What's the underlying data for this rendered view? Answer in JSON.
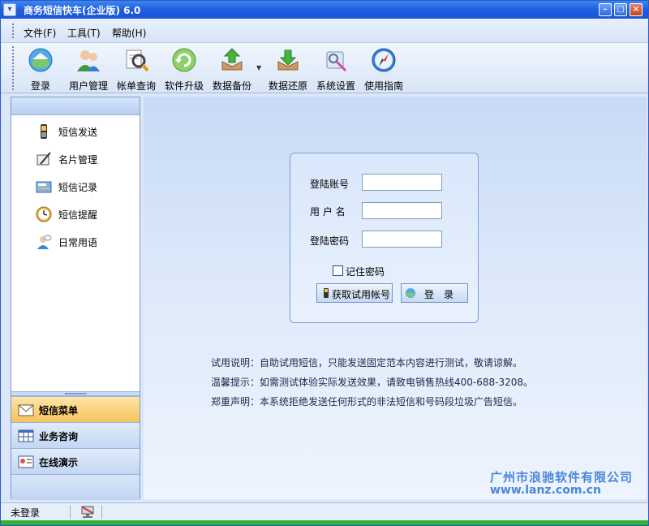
{
  "window": {
    "title": "商务短信快车(企业版) 6.0"
  },
  "menu": {
    "items": [
      "文件(F)",
      "工具(T)",
      "帮助(H)"
    ]
  },
  "toolbar": {
    "items": [
      {
        "label": "登录",
        "icon": "login-icon"
      },
      {
        "label": "用户管理",
        "icon": "users-icon"
      },
      {
        "label": "帐单查询",
        "icon": "billing-search-icon"
      },
      {
        "label": "软件升级",
        "icon": "upgrade-icon"
      },
      {
        "label": "数据备份",
        "icon": "backup-icon"
      },
      {
        "label": "数据还原",
        "icon": "restore-icon"
      },
      {
        "label": "系统设置",
        "icon": "settings-icon"
      },
      {
        "label": "使用指南",
        "icon": "guide-icon"
      }
    ]
  },
  "sidebar": {
    "items": [
      {
        "label": "短信发送",
        "icon": "mobile-phone-icon"
      },
      {
        "label": "名片管理",
        "icon": "business-card-icon"
      },
      {
        "label": "短信记录",
        "icon": "sms-record-icon"
      },
      {
        "label": "短信提醒",
        "icon": "clock-reminder-icon"
      },
      {
        "label": "日常用语",
        "icon": "phrases-icon"
      }
    ],
    "nav": [
      {
        "label": "短信菜单",
        "icon": "envelope-icon",
        "active": true
      },
      {
        "label": "业务咨询",
        "icon": "calendar-grid-icon",
        "active": false
      },
      {
        "label": "在线演示",
        "icon": "id-card-icon",
        "active": false
      }
    ]
  },
  "login": {
    "account_label": "登陆账号",
    "username_label": "用 户 名",
    "password_label": "登陆密码",
    "account_value": "",
    "username_value": "",
    "password_value": "",
    "remember_label": "记住密码",
    "remember_checked": false,
    "trial_button": "获取试用帐号",
    "login_button": "登　录"
  },
  "notices": [
    "试用说明：自助试用短信，只能发送固定范本内容进行测试，敬请谅解。",
    "温馨提示：如需测试体验实际发送效果，请致电销售热线400-688-3208。",
    "郑重声明：本系统拒绝发送任何形式的非法短信和号码段垃圾广告短信。"
  ],
  "watermark": {
    "company": "广州市浪驰软件有限公司",
    "url": "www.lanz.com.cn"
  },
  "status": {
    "text": "未登录"
  },
  "colors": {
    "titlebar": "#1d5ee0",
    "active_nav": "#f7c25d",
    "accent": "#4a86d8"
  }
}
